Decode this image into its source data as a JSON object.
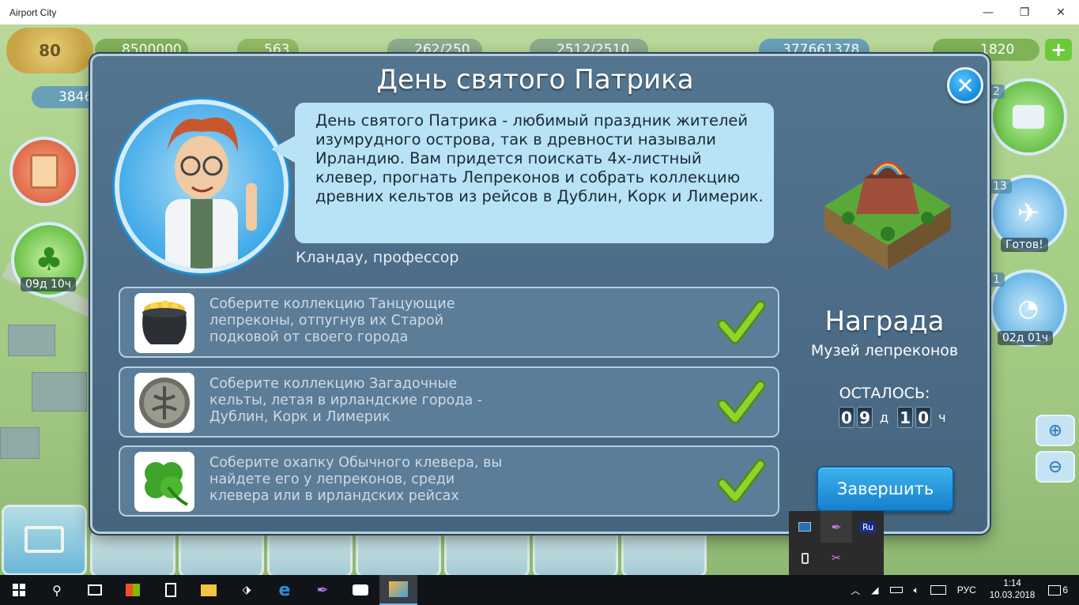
{
  "window": {
    "title": "Airport City",
    "minimize": "—",
    "maximize": "❐",
    "close": "✕"
  },
  "hud": {
    "level": "80",
    "coins": "8500000",
    "stars": "563",
    "fuel": "262/250",
    "cargo": "2512/2510",
    "money": "377661378",
    "bucks": "1820",
    "population": "3846",
    "left_timer": "09д 10ч",
    "right_timer": "02д 01ч",
    "right_ready": "Готов!",
    "right_count_1": "2",
    "right_count_2": "13",
    "right_count_3": "1"
  },
  "dialog": {
    "title": "День святого Патрика",
    "close_symbol": "✕",
    "speech": "День святого Патрика - любимый праздник жителей изумрудного острова, так в древности называли Ирландию. Вам придется поискать 4х-листный клевер, прогнать Лепреконов и собрать коллекцию древних кельтов из рейсов в Дублин, Корк и Лимерик.",
    "author": "Кландау, профессор",
    "tasks": [
      {
        "text": "Соберите коллекцию Танцующие лепреконы, отпугнув их Старой подковой от своего города",
        "icon": "pot-of-gold-icon",
        "done": true
      },
      {
        "text": "Соберите коллекцию Загадочные кельты, летая в ирландские города - Дублин, Корк и Лимерик",
        "icon": "celtic-coin-icon",
        "done": true
      },
      {
        "text": "Соберите охапку Обычного клевера, вы найдете его у лепреконов, среди клевера или в ирландских рейсах",
        "icon": "clover-icon",
        "done": true
      }
    ],
    "reward_title": "Награда",
    "reward_name": "Музей лепреконов",
    "remaining_label": "ОСТАЛОСЬ:",
    "timer": {
      "days_d1": "0",
      "days_d2": "9",
      "days_unit": "д",
      "hours_d1": "1",
      "hours_d2": "0",
      "hours_unit": "ч"
    },
    "finish_button": "Завершить"
  },
  "tray_popup": {
    "ru_label": "Ru"
  },
  "taskbar": {
    "language": "РУС",
    "time": "1:14",
    "date": "10.03.2018",
    "notifications": "6"
  },
  "colors": {
    "dialog_bg": "#4b6b88",
    "accent_blue": "#1a8be0",
    "check_green": "#7ec21a"
  }
}
